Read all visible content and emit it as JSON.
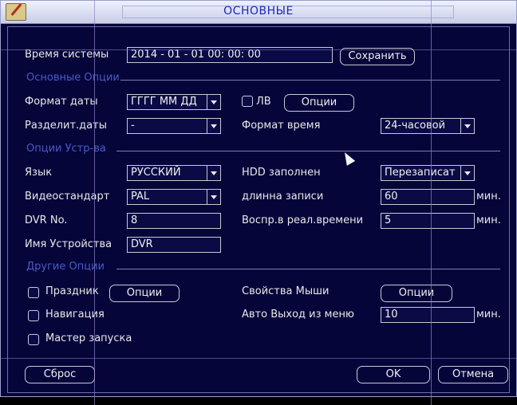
{
  "window": {
    "title": "ОСНОВНЫЕ"
  },
  "system_time": {
    "label": "Время системы",
    "value": "2014 - 01 - 01   00: 00: 00",
    "save_label": "Сохранить"
  },
  "sections": {
    "basic": "Основные Опции",
    "device": "Опции Устр-ва",
    "other": "Другие Опции"
  },
  "date_format": {
    "label": "Формат даты",
    "value": "ГГГГ ММ ДД",
    "dst_label": "ЛВ",
    "options_label": "Опции"
  },
  "date_separator": {
    "label": "Разделит.даты",
    "value": "-"
  },
  "time_format": {
    "label": "Формат время",
    "value": "24-часовой"
  },
  "language": {
    "label": "Язык",
    "value": "РУССКИЙ"
  },
  "hdd_full": {
    "label": "HDD заполнен",
    "value": "Перезаписат"
  },
  "video_standard": {
    "label": "Видеостандарт",
    "value": "PAL"
  },
  "record_length": {
    "label": "длинна записи",
    "value": "60",
    "unit": "мин."
  },
  "dvr_no": {
    "label": "DVR No.",
    "value": "8"
  },
  "realtime_playback": {
    "label": "Воспр.в реал.времени",
    "value": "5",
    "unit": "мин."
  },
  "device_name": {
    "label": "Имя Устройства",
    "value": "DVR"
  },
  "holiday": {
    "label": "Праздник",
    "options_label": "Опции"
  },
  "mouse": {
    "label": "Свойства Мыши",
    "options_label": "Опции"
  },
  "navigation": {
    "label": "Навигация"
  },
  "auto_logout": {
    "label": "Авто Выход из меню",
    "value": "10",
    "unit": "мин."
  },
  "startup_wizard": {
    "label": "Мастер запуска"
  },
  "footer": {
    "reset_label": "Сброс",
    "ok_label": "OK",
    "cancel_label": "Отмена"
  },
  "icons": {
    "app": "settings-app-icon",
    "cursor": "mouse-pointer-icon"
  },
  "colors": {
    "background": "#05053a",
    "section_text": "#4a5ac8",
    "title_text": "#1a28b8"
  }
}
